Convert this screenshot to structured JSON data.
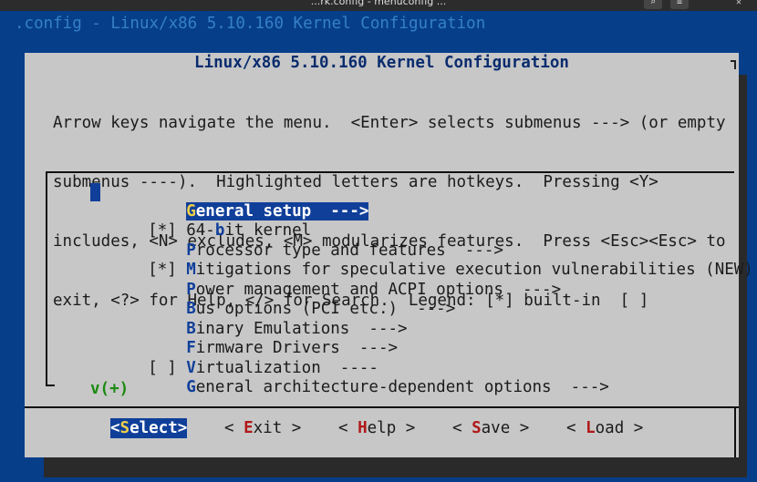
{
  "window": {
    "title": "...rk.config - menuconfig ...",
    "buttons": [
      "search-icon",
      "menu-icon",
      "close-icon"
    ]
  },
  "terminal": {
    "config_title": ".config - Linux/x86 5.10.160 Kernel Configuration"
  },
  "dialog": {
    "title": "Linux/x86 5.10.160 Kernel Configuration",
    "help_lines": [
      "Arrow keys navigate the menu.  <Enter> selects submenus ---> (or empty",
      "submenus ----).  Highlighted letters are hotkeys.  Pressing <Y>",
      "includes, <N> excludes, <M> modularizes features.  Press <Esc><Esc> to",
      "exit, <?> for Help, </> for Search.  Legend: [*] built-in  [ ]"
    ],
    "more_indicator": "v(+)"
  },
  "menu": {
    "items": [
      {
        "checkbox": "",
        "hotkey": "G",
        "rest": "eneral setup  --->",
        "selected": true
      },
      {
        "checkbox": "[*]",
        "pre": "64-",
        "hotkey": "b",
        "rest": "it kernel"
      },
      {
        "checkbox": "",
        "hotkey": "P",
        "rest": "rocessor type and features  --->"
      },
      {
        "checkbox": "[*]",
        "hotkey": "M",
        "rest": "itigations for speculative execution vulnerabilities (NEW)"
      },
      {
        "checkbox": "",
        "hotkey": "P",
        "rest": "ower management and ACPI options  --->"
      },
      {
        "checkbox": "",
        "hotkey": "B",
        "rest": "us options (PCI etc.)  --->"
      },
      {
        "checkbox": "",
        "hotkey": "B",
        "rest": "inary Emulations  --->"
      },
      {
        "checkbox": "",
        "hotkey": "F",
        "rest": "irmware Drivers  --->"
      },
      {
        "checkbox": "[ ]",
        "hotkey": "V",
        "rest": "irtualization  ----"
      },
      {
        "checkbox": "",
        "hotkey": "G",
        "rest": "eneral architecture-dependent options  --->"
      }
    ]
  },
  "buttons": {
    "select": {
      "open": "<",
      "hotkey": "S",
      "rest": "elect",
      "close": ">"
    },
    "exit": {
      "open": "< ",
      "hotkey": "E",
      "rest": "xit",
      "close": " >"
    },
    "help": {
      "open": "< ",
      "hotkey": "H",
      "rest": "elp",
      "close": " >"
    },
    "save": {
      "open": "< ",
      "hotkey": "S",
      "rest": "ave",
      "close": " >"
    },
    "load": {
      "open": "< ",
      "hotkey": "L",
      "rest": "oad",
      "close": " >"
    }
  },
  "colors": {
    "background": "#063e8a",
    "dialog": "#c7c7c7",
    "highlight": "#103f9a",
    "hotkey_selected": "#f0d04a",
    "button_hotkey": "#b01818"
  }
}
